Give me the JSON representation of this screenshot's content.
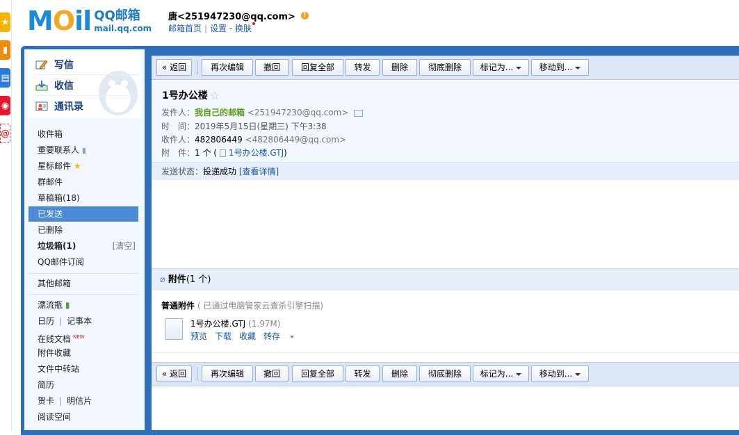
{
  "header": {
    "logo_cn": "QQ邮箱",
    "logo_en": "mail.qq.com",
    "user": "唐<251947230@qq.com>",
    "links": [
      "邮箱首页",
      "设置",
      "换肤"
    ]
  },
  "sidebar": {
    "write": "写信",
    "receive": "收信",
    "contacts": "通讯录",
    "folders": [
      {
        "label": "收件箱"
      },
      {
        "label": "重要联系人"
      },
      {
        "label": "星标邮件"
      },
      {
        "label": "群邮件"
      },
      {
        "label": "草稿箱(18)"
      },
      {
        "label": "已发送"
      },
      {
        "label": "已删除"
      },
      {
        "label": "垃圾箱(1)",
        "action": "[清空]"
      },
      {
        "label": "QQ邮件订阅"
      }
    ],
    "other": "其他邮箱",
    "apps": {
      "drift": "漂流瓶",
      "calendar": "日历",
      "notebook": "记事本",
      "docs": "在线文档",
      "docs_badge": "NEW",
      "attach_fav": "附件收藏",
      "transfer": "文件中转站",
      "resume": "简历",
      "card": "贺卡",
      "postcard": "明信片",
      "reading": "阅读空间"
    }
  },
  "toolbar": {
    "back": "« 返回",
    "reedit": "再次编辑",
    "recall": "撤回",
    "reply_all": "回复全部",
    "forward": "转发",
    "delete": "删除",
    "delete_perm": "彻底删除",
    "mark_as": "标记为...",
    "move_to": "移动到..."
  },
  "mail": {
    "subject": "1号办公楼",
    "star": "☆",
    "from_label": "发件人：",
    "from_name": "我自己的邮箱",
    "from_addr": "<251947230@qq.com>",
    "time_label": "时　间：",
    "time": "2019年5月15日(星期三) 下午3:38",
    "to_label": "收件人：",
    "to_name": "482806449",
    "to_addr": "<482806449@qq.com>",
    "att_label": "附　件：",
    "att_count": "1 个 (",
    "att_name": "1号办公楼.GTJ",
    "att_close": ")",
    "status_label": "发送状态：",
    "status_value": "投递成功",
    "status_link": "[查看详情]"
  },
  "attachments": {
    "title": "附件",
    "count": "(1 个)",
    "section": "普通附件",
    "scan_note": "( 已通过电脑管家云查杀引擎扫描)",
    "file_name": "1号办公楼.GTJ",
    "file_size": "(1.97M)",
    "actions": [
      "预览",
      "下载",
      "收藏",
      "转存"
    ]
  },
  "colors": {
    "frame": "#2e6fb7",
    "sidebar_bg": "#f2f7fd",
    "active_folder": "#4a8ad6",
    "link": "#1c5ba8",
    "sender_green": "#5f9a1a"
  }
}
